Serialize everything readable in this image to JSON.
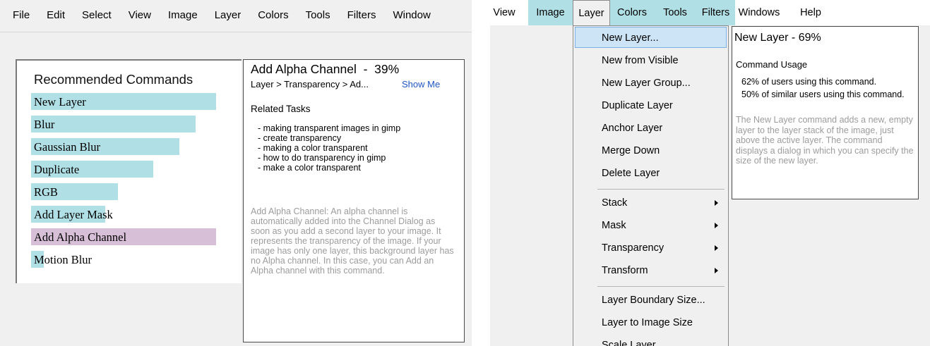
{
  "left_panel": {
    "menubar": [
      "File",
      "Edit",
      "Select",
      "View",
      "Image",
      "Layer",
      "Colors",
      "Tools",
      "Filters",
      "Window"
    ],
    "recommended": {
      "title": "Recommended Commands",
      "items": [
        {
          "label": "New Layer",
          "bar_fraction": 1.0,
          "highlighted": false
        },
        {
          "label": "Blur",
          "bar_fraction": 0.89,
          "highlighted": false
        },
        {
          "label": "Gaussian Blur",
          "bar_fraction": 0.8,
          "highlighted": false
        },
        {
          "label": "Duplicate",
          "bar_fraction": 0.66,
          "highlighted": false
        },
        {
          "label": "RGB",
          "bar_fraction": 0.47,
          "highlighted": false
        },
        {
          "label": "Add Layer Mask",
          "bar_fraction": 0.4,
          "highlighted": false
        },
        {
          "label": "Add Alpha Channel",
          "bar_fraction": 1.0,
          "highlighted": true
        },
        {
          "label": "Motion Blur",
          "bar_fraction": 0.07,
          "highlighted": false
        }
      ]
    },
    "detail": {
      "title": "Add Alpha Channel  -  39%",
      "path": "Layer > Transparency > Ad...",
      "show_me": "Show Me",
      "related_heading": "Related Tasks",
      "tasks": [
        "- making transparent images in gimp",
        "- create transparency",
        "- making a color transparent",
        "- how to do transparency in gimp",
        "- make a color transparent"
      ],
      "description": "Add Alpha Channel: An alpha channel is automatically added into the Channel Dialog as soon as you add a second layer to your image. It represents the transparency of the image. If your image has only one layer, this background layer has no Alpha channel. In this case, you can Add an Alpha channel with this command."
    }
  },
  "right_panel": {
    "menubar": [
      {
        "label": "View",
        "highlighted": false,
        "active": false
      },
      {
        "label": "Image",
        "highlighted": true,
        "active": false
      },
      {
        "label": "Layer",
        "highlighted": false,
        "active": true
      },
      {
        "label": "Colors",
        "highlighted": true,
        "active": false
      },
      {
        "label": "Tools",
        "highlighted": true,
        "active": false
      },
      {
        "label": "Filters",
        "highlighted": true,
        "active": false
      },
      {
        "label": "Windows",
        "highlighted": false,
        "active": false
      },
      {
        "label": "Help",
        "highlighted": false,
        "active": false
      }
    ],
    "dropdown_items": [
      {
        "label": "New Layer...",
        "selected": true,
        "submenu": false
      },
      {
        "label": "New from Visible",
        "selected": false,
        "submenu": false
      },
      {
        "label": "New Layer Group...",
        "selected": false,
        "submenu": false
      },
      {
        "label": "Duplicate Layer",
        "selected": false,
        "submenu": false
      },
      {
        "label": "Anchor Layer",
        "selected": false,
        "submenu": false
      },
      {
        "label": "Merge Down",
        "selected": false,
        "submenu": false
      },
      {
        "label": "Delete Layer",
        "selected": false,
        "submenu": false
      },
      {
        "label": "Stack",
        "selected": false,
        "submenu": true
      },
      {
        "label": "Mask",
        "selected": false,
        "submenu": true
      },
      {
        "label": "Transparency",
        "selected": false,
        "submenu": true
      },
      {
        "label": "Transform",
        "selected": false,
        "submenu": true
      },
      {
        "label": "Layer Boundary Size...",
        "selected": false,
        "submenu": false
      },
      {
        "label": "Layer to Image Size",
        "selected": false,
        "submenu": false
      },
      {
        "label": "Scale Layer...",
        "selected": false,
        "submenu": false
      }
    ],
    "tooltip": {
      "title": "New Layer - 69%",
      "usage_heading": "Command Usage",
      "stat_users": "62% of users using this command.",
      "stat_similar": "50% of similar users using this command.",
      "description": "The New Layer command adds a new, empty layer to the layer stack of the image, just above the active layer. The command displays a dialog in which you can specify the size of the new layer."
    }
  },
  "colors": {
    "bar": "#b0e0e6",
    "bar_highlight": "#d8bfd8",
    "menu_highlight": "#b0e0e6",
    "link": "#1f56c2",
    "muted_text": "#9c9c9c"
  }
}
